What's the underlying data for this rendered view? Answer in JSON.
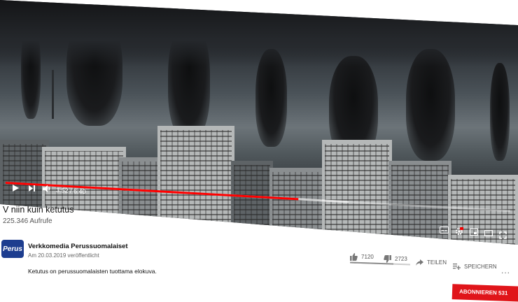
{
  "player": {
    "time_current": "3:52",
    "time_separator": " / ",
    "time_total": "6:40",
    "progress": 0.58,
    "buffered": 0.68
  },
  "video": {
    "title": "V niin kuin ketutus",
    "views": "225.346 Aufrufe"
  },
  "channel": {
    "avatar_text": "Perus",
    "name": "Verkkomedia Perussuomalaiset",
    "published": "Am 20.03.2019 veröffentlicht"
  },
  "description": "Ketutus on perussuomalaisten tuottama elokuva.",
  "actions": {
    "likes": "7120",
    "dislikes": "2723",
    "like_ratio": 0.72,
    "share_label": "TEILEN",
    "save_label": "SPEICHERN",
    "more_label": "..."
  },
  "subscribe": {
    "label": "ABONNIEREN",
    "count": "531"
  },
  "colors": {
    "accent": "#ff0000",
    "subscribe": "#e0151a",
    "channel_avatar": "#1d3d8f"
  },
  "icons": [
    "play-icon",
    "next-icon",
    "volume-icon",
    "subtitles-icon",
    "settings-icon",
    "miniplayer-icon",
    "theater-icon",
    "fullscreen-icon",
    "thumbs-up-icon",
    "thumbs-down-icon",
    "share-icon",
    "add-to-playlist-icon"
  ]
}
